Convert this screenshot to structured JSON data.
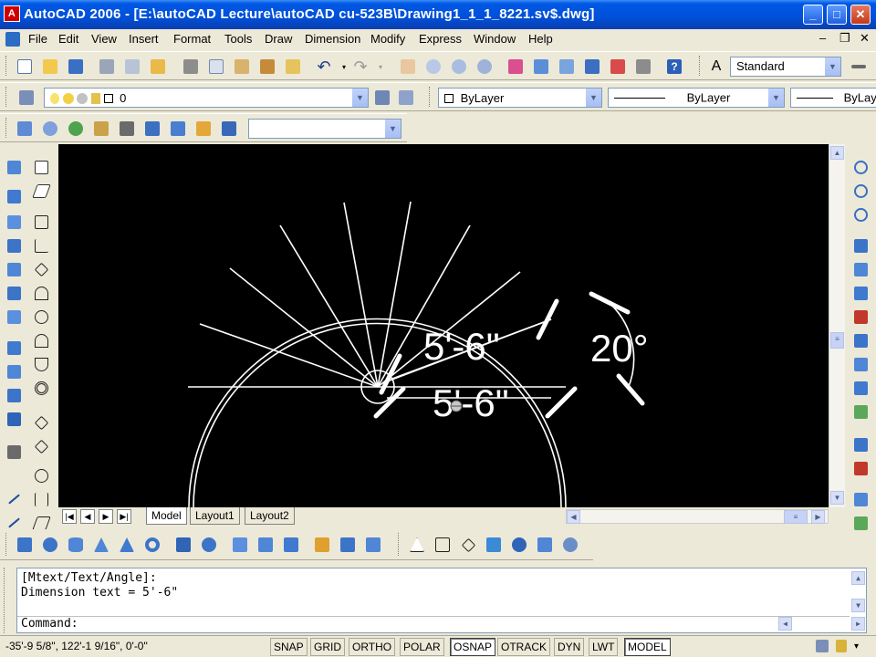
{
  "window": {
    "title": "AutoCAD 2006 - [E:\\autoCAD Lecture\\autoCAD cu-523B\\Drawing1_1_1_8221.sv$.dwg]",
    "app_icon": "A"
  },
  "menu": {
    "items": [
      "File",
      "Edit",
      "View",
      "Insert",
      "Format",
      "Tools",
      "Draw",
      "Dimension",
      "Modify",
      "Express",
      "Window",
      "Help"
    ]
  },
  "toolbars": {
    "text_style": "Standard",
    "layer_name": "0",
    "color": "ByLayer",
    "linetype": "ByLayer",
    "lineweight": "ByLayer",
    "view_select": ""
  },
  "drawing": {
    "dim_aligned": "5'-6\"",
    "dim_linear": "5'-6\"",
    "dim_angle": "20°"
  },
  "layout_tabs": [
    "Model",
    "Layout1",
    "Layout2"
  ],
  "command": {
    "history": [
      "[Mtext/Text/Angle]:",
      "Dimension text = 5'-6\""
    ],
    "prompt": "Command:"
  },
  "status": {
    "coords": "-35'-9 5/8\", 122'-1 9/16\", 0'-0\"",
    "toggles": [
      "SNAP",
      "GRID",
      "ORTHO",
      "POLAR",
      "OSNAP",
      "OTRACK",
      "DYN",
      "LWT",
      "MODEL"
    ]
  },
  "colors": {
    "titlebar": "#0050d8",
    "canvas": "#000000",
    "chrome": "#ece9d8",
    "drawing_lines": "#ffffff"
  }
}
